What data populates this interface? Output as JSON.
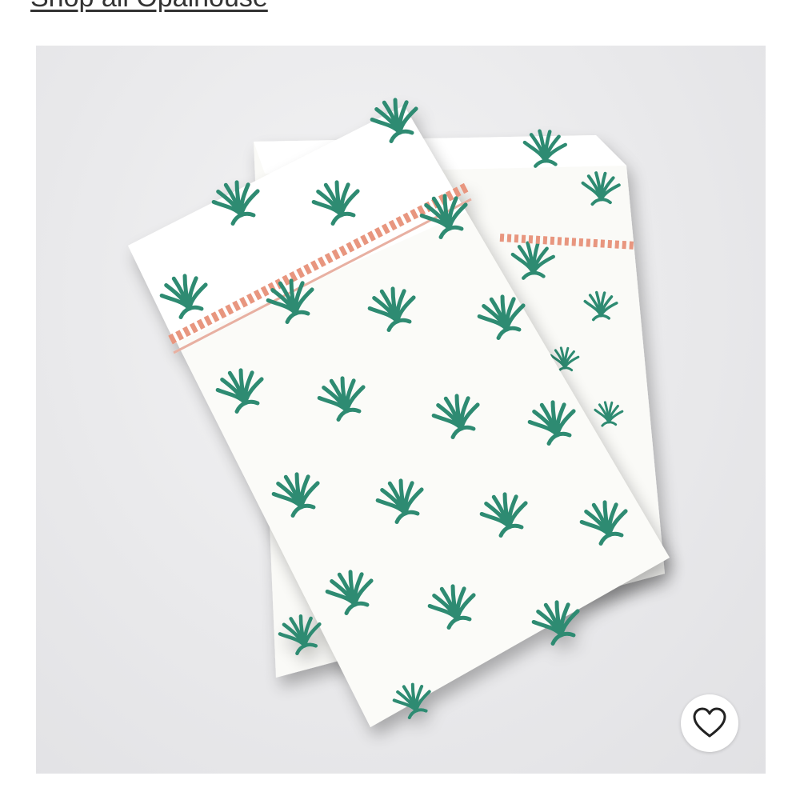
{
  "header": {
    "shop_link": "Shop all Opalhouse"
  },
  "product_image": {
    "motif_color": "#2e8b72",
    "stitch_color": "#e8967f"
  },
  "favorite": {
    "icon": "heart-outline-icon"
  }
}
